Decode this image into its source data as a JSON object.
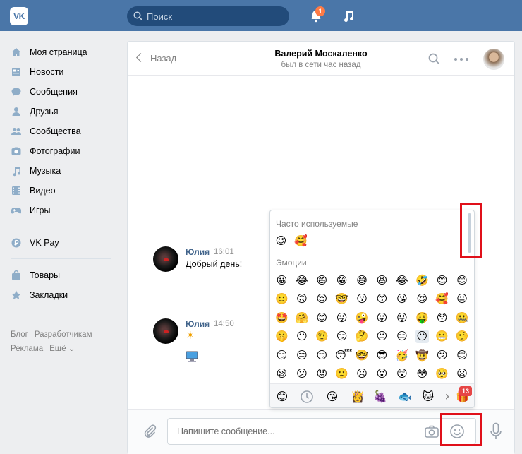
{
  "topbar": {
    "logo": "VK",
    "search_placeholder": "Поиск",
    "notifications_badge": "1"
  },
  "sidebar": {
    "items": [
      {
        "label": "Моя страница",
        "icon": "home-icon"
      },
      {
        "label": "Новости",
        "icon": "news-icon"
      },
      {
        "label": "Сообщения",
        "icon": "messages-icon"
      },
      {
        "label": "Друзья",
        "icon": "friends-icon"
      },
      {
        "label": "Сообщества",
        "icon": "communities-icon"
      },
      {
        "label": "Фотографии",
        "icon": "camera-icon"
      },
      {
        "label": "Музыка",
        "icon": "music-icon"
      },
      {
        "label": "Видео",
        "icon": "video-icon"
      },
      {
        "label": "Игры",
        "icon": "gamepad-icon"
      }
    ],
    "vkpay": {
      "label": "VK Pay",
      "icon": "vkpay-icon"
    },
    "extra": [
      {
        "label": "Товары",
        "icon": "bag-icon"
      },
      {
        "label": "Закладки",
        "icon": "star-icon"
      }
    ],
    "footer": {
      "blog": "Блог",
      "developers": "Разработчикам",
      "ads": "Реклама",
      "more": "Ещё ⌄"
    }
  },
  "chat": {
    "back_label": "Назад",
    "peer_name": "Валерий Москаленко",
    "peer_status": "был в сети час назад",
    "messages": [
      {
        "author": "Юлия",
        "time": "16:01",
        "text": "Добрый день!"
      },
      {
        "author": "Юлия",
        "time": "14:50",
        "text": "☀"
      }
    ],
    "input_placeholder": "Напишите сообщение..."
  },
  "emoji_panel": {
    "frequent_title": "Часто используемые",
    "frequent": [
      "😉",
      "🥰"
    ],
    "emotions_title": "Эмоции",
    "rows": [
      [
        "😀",
        "😂",
        "😄",
        "😁",
        "😅",
        "😆",
        "😂",
        "🤣",
        "😊",
        "😊"
      ],
      [
        "🙂",
        "🙃",
        "😌",
        "🤓",
        "😗",
        "😙",
        "😘",
        "😍",
        "🥰",
        "😐"
      ],
      [
        "🤩",
        "🤗",
        "😊",
        "😜",
        "🤪",
        "😛",
        "😝",
        "🤑",
        "😯",
        "🤐"
      ],
      [
        "🤫",
        "😶",
        "🤨",
        "😏",
        "🤔",
        "😐",
        "😑",
        "😶",
        "😬",
        "🤥"
      ],
      [
        "😏",
        "😒",
        "😏",
        "😴",
        "🤓",
        "😎",
        "🥳",
        "🤠",
        "😕",
        "😌"
      ],
      [
        "😪",
        "😕",
        "😟",
        "🙁",
        "☹",
        "😮",
        "😲",
        "😳",
        "🥺",
        "😦"
      ]
    ],
    "tabs": [
      "😊",
      "🕒",
      "😘",
      "👸",
      "🍇",
      "🐟",
      "🐱",
      "›",
      "🎁"
    ],
    "tabs_badge": "13"
  },
  "colors": {
    "header": "#4a76a8",
    "link": "#42648b",
    "highlight": "#e0101a"
  }
}
